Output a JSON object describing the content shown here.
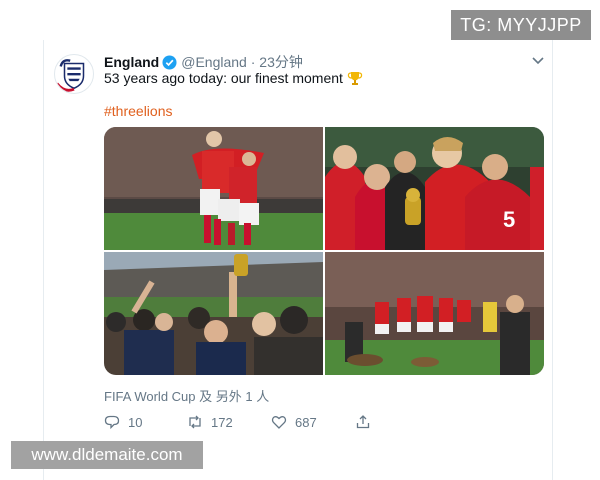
{
  "watermarks": {
    "top": "TG: MYYJJPP",
    "bottom": "www.dldemaite.com"
  },
  "tweet": {
    "author_name": "England",
    "handle": "@England",
    "separator": "·",
    "time": "23分钟",
    "text": "53 years ago today: our finest moment",
    "hashtag": "#threelions",
    "tagged": "FIFA World Cup 及 另外 1 人"
  },
  "media": {
    "photos": [
      {
        "subject": "players-embracing-photo"
      },
      {
        "subject": "trophy-celebration-photo"
      },
      {
        "subject": "trophy-raised-crowd-photo"
      },
      {
        "subject": "team-lap-of-honour-photo"
      }
    ]
  },
  "actions": {
    "replies": "10",
    "retweets": "172",
    "likes": "687"
  },
  "icons": {
    "verified": "verified-badge-icon",
    "caret": "chevron-down-icon",
    "trophy": "trophy-emoji-icon",
    "reply": "reply-icon",
    "retweet": "retweet-icon",
    "like": "heart-icon",
    "share": "share-icon"
  },
  "colors": {
    "hashtag": "#e0601e",
    "verified": "#1da1f2",
    "secondary_text": "#657786",
    "england_red": "#c8102e",
    "england_blue": "#1a2b6b"
  }
}
